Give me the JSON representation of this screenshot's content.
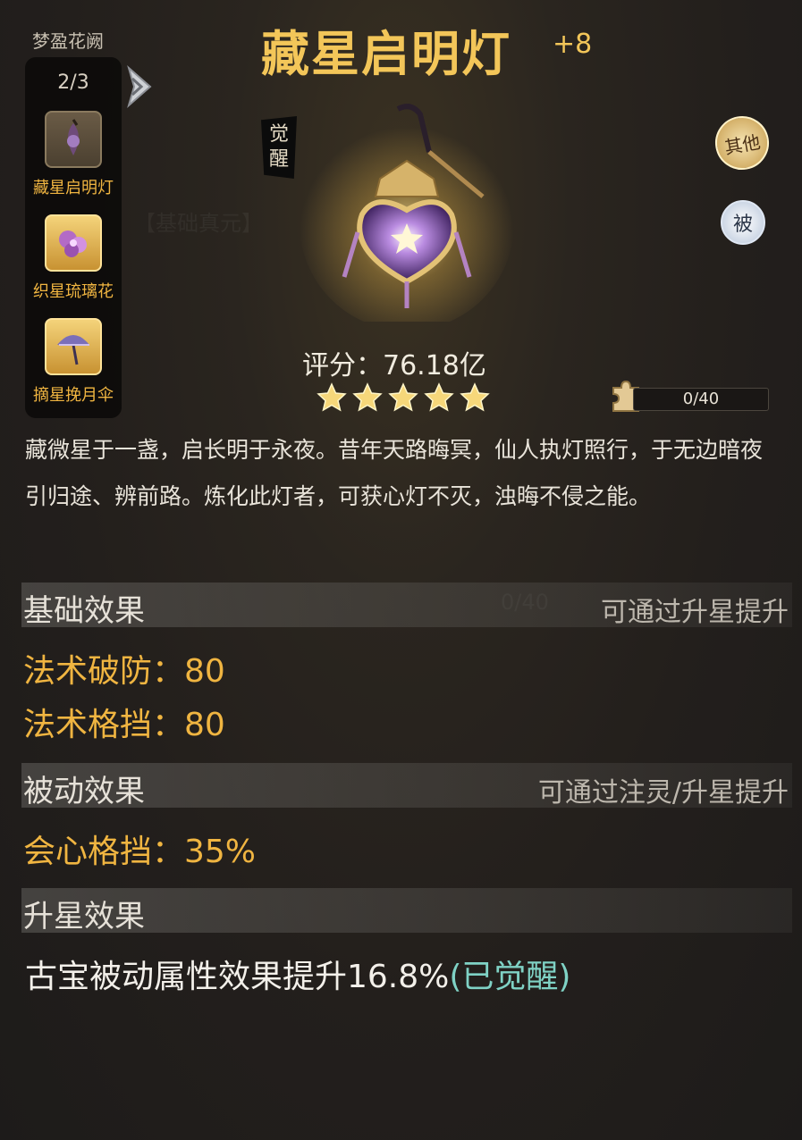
{
  "set": {
    "name": "梦盈花阙",
    "count": "2/3",
    "items": [
      {
        "label": "藏星启明灯",
        "state": "dim"
      },
      {
        "label": "织星琉璃花",
        "state": "owned"
      },
      {
        "label": "摘星挽月伞",
        "state": "owned"
      }
    ]
  },
  "item": {
    "name": "藏星启明灯",
    "level": "+8",
    "awakened_tag": [
      "觉",
      "醒"
    ],
    "badge_other": [
      "其",
      "他"
    ],
    "badge_passive": "被",
    "score_label": "评分：76.18亿",
    "stars": 5,
    "shards": "0/40",
    "description": "藏微星于一盏，启长明于永夜。昔年天路晦冥，仙人执灯照行，于无边暗夜引归途、辨前路。炼化此灯者，可获心灯不灭，浊晦不侵之能。"
  },
  "base_effect": {
    "title": "基础效果",
    "hint": "可通过升星提升",
    "stats": [
      "法术破防：80",
      "法术格挡：80"
    ]
  },
  "passive_effect": {
    "title": "被动效果",
    "hint": "可通过注灵/升星提升",
    "stats": [
      "会心格挡：35%"
    ]
  },
  "star_effect": {
    "title": "升星效果",
    "text": "古宝被动属性效果提升16.8%",
    "awakened": "(已觉醒)"
  },
  "colors": {
    "gold": "#f3c659",
    "stat": "#f0b541",
    "awakened": "#7fd2c5"
  }
}
